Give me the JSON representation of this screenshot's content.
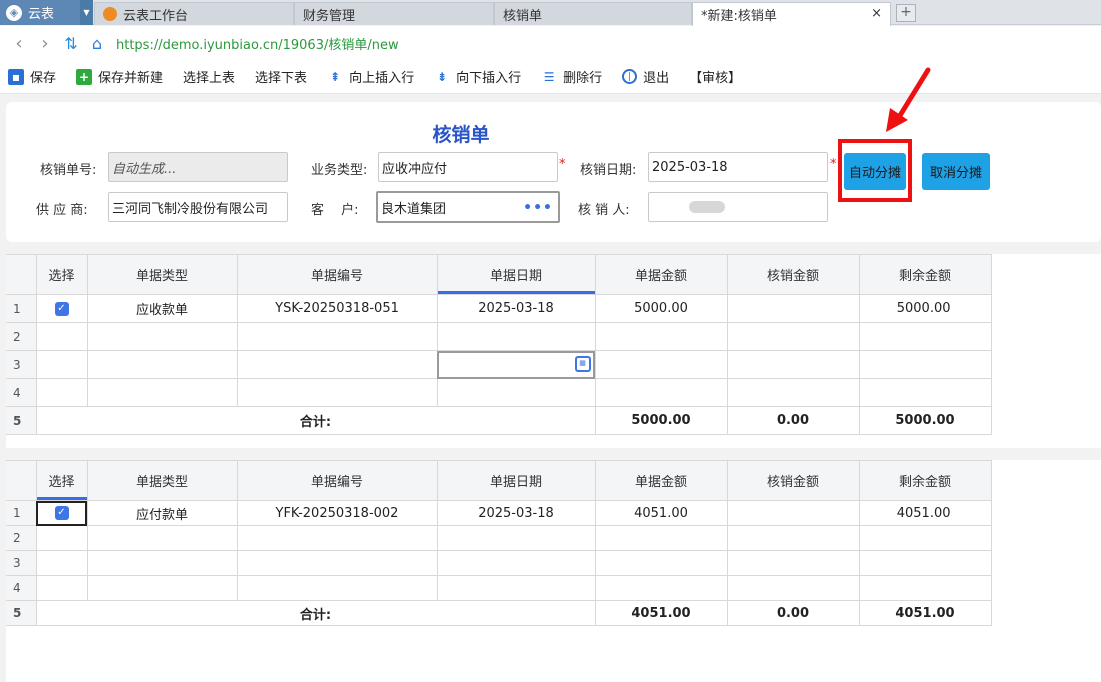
{
  "app": {
    "name": "云表",
    "logo_icon": "yunbiao-logo-icon"
  },
  "tabs": [
    {
      "label": "云表工作台",
      "active": false
    },
    {
      "label": "财务管理",
      "active": false
    },
    {
      "label": "核销单",
      "active": false
    },
    {
      "label": "*新建:核销单",
      "active": true,
      "close": "×"
    }
  ],
  "newtab_label": "+",
  "address": {
    "url": "https://demo.iyunbiao.cn/19063/核销单/new"
  },
  "toolbar": {
    "save": "保存",
    "save_new": "保存并新建",
    "select_prev": "选择上表",
    "select_next": "选择下表",
    "insert_up": "向上插入行",
    "insert_down": "向下插入行",
    "delete_row": "删除行",
    "exit": "退出",
    "audit": "【审核】"
  },
  "form": {
    "title": "核销单",
    "number_label": "核销单号:",
    "number_value": "自动生成...",
    "biz_type_label": "业务类型:",
    "biz_type_value": "应收冲应付",
    "date_label": "核销日期:",
    "date_value": "2025-03-18",
    "supplier_label": "供 应 商:",
    "supplier_value": "三河同飞制冷股份有限公司",
    "customer_label": "客　 户:",
    "customer_value": "良木道集团",
    "customer_more": "•••",
    "operator_label": "核 销 人:",
    "required_mark": "*",
    "auto_allocate": "自动分摊",
    "cancel_allocate": "取消分摊"
  },
  "grid_headers": [
    "选择",
    "单据类型",
    "单据编号",
    "单据日期",
    "单据金额",
    "核销金额",
    "剩余金额"
  ],
  "grid1": {
    "rows": [
      {
        "n": "1",
        "checked": true,
        "type": "应收款单",
        "code": "YSK-20250318-051",
        "date": "2025-03-18",
        "amount": "5000.00",
        "writeoff": "",
        "remain": "5000.00"
      },
      {
        "n": "2",
        "checked": false,
        "type": "",
        "code": "",
        "date": "",
        "amount": "",
        "writeoff": "",
        "remain": ""
      },
      {
        "n": "3",
        "checked": false,
        "type": "",
        "code": "",
        "date": "",
        "amount": "",
        "writeoff": "",
        "remain": ""
      },
      {
        "n": "4",
        "checked": false,
        "type": "",
        "code": "",
        "date": "",
        "amount": "",
        "writeoff": "",
        "remain": ""
      }
    ],
    "total": {
      "n": "5",
      "label": "合计:",
      "amount": "5000.00",
      "writeoff": "0.00",
      "remain": "5000.00"
    }
  },
  "grid2": {
    "rows": [
      {
        "n": "1",
        "checked": true,
        "type": "应付款单",
        "code": "YFK-20250318-002",
        "date": "2025-03-18",
        "amount": "4051.00",
        "writeoff": "",
        "remain": "4051.00"
      },
      {
        "n": "2",
        "checked": false,
        "type": "",
        "code": "",
        "date": "",
        "amount": "",
        "writeoff": "",
        "remain": ""
      },
      {
        "n": "3",
        "checked": false,
        "type": "",
        "code": "",
        "date": "",
        "amount": "",
        "writeoff": "",
        "remain": ""
      },
      {
        "n": "4",
        "checked": false,
        "type": "",
        "code": "",
        "date": "",
        "amount": "",
        "writeoff": "",
        "remain": ""
      }
    ],
    "total": {
      "n": "5",
      "label": "合计:",
      "amount": "4051.00",
      "writeoff": "0.00",
      "remain": "4051.00"
    }
  },
  "colors": {
    "accent": "#1ea1e5",
    "title": "#2a55c8",
    "highlight": "#ee1111",
    "tab_app": "#5d88b5"
  }
}
